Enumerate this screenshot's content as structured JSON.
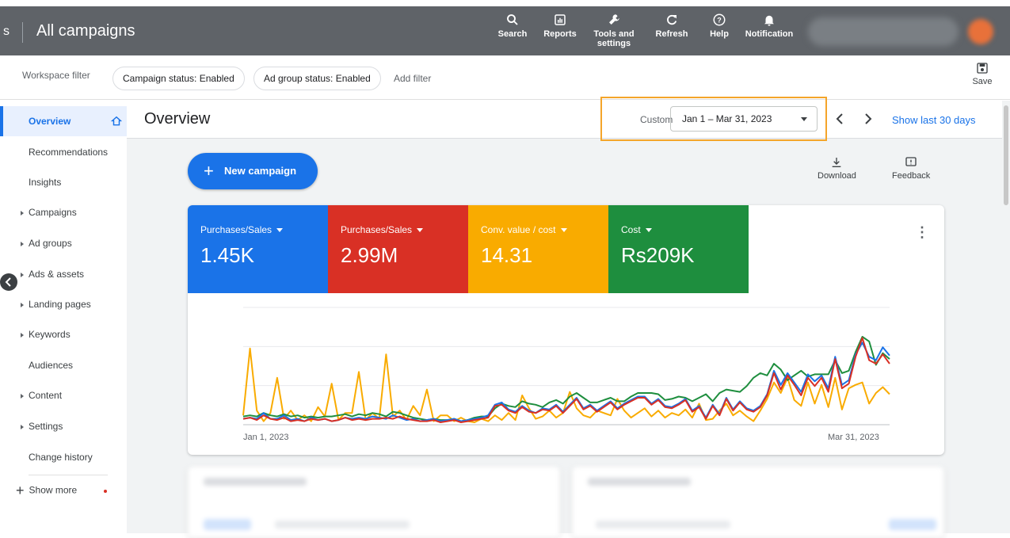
{
  "topbar": {
    "title_fragment": "s",
    "title": "All campaigns",
    "tools": [
      {
        "label": "Search",
        "icon": "search-icon"
      },
      {
        "label": "Reports",
        "icon": "reports-icon"
      },
      {
        "label": "Tools and settings",
        "icon": "wrench-icon"
      },
      {
        "label": "Refresh",
        "icon": "refresh-icon"
      },
      {
        "label": "Help",
        "icon": "help-icon"
      },
      {
        "label": "Notification",
        "icon": "bell-icon"
      }
    ]
  },
  "filterbar": {
    "workspace_filter": "Workspace filter",
    "chips": [
      "Campaign status: Enabled",
      "Ad group status: Enabled"
    ],
    "add_filter": "Add filter",
    "save": "Save"
  },
  "sidebar": {
    "items": [
      {
        "label": "Overview",
        "expandable": false,
        "active": true
      },
      {
        "label": "Recommendations",
        "expandable": false
      },
      {
        "label": "Insights",
        "expandable": false
      },
      {
        "label": "Campaigns",
        "expandable": true
      },
      {
        "label": "Ad groups",
        "expandable": true
      },
      {
        "label": "Ads & assets",
        "expandable": true
      },
      {
        "label": "Landing pages",
        "expandable": true
      },
      {
        "label": "Keywords",
        "expandable": true
      },
      {
        "label": "Audiences",
        "expandable": false
      },
      {
        "label": "Content",
        "expandable": true
      },
      {
        "label": "Settings",
        "expandable": true
      },
      {
        "label": "Change history",
        "expandable": false
      }
    ],
    "show_more": "Show more"
  },
  "main": {
    "page_title": "Overview",
    "date_custom": "Custom",
    "date_range": "Jan 1 – Mar 31, 2023",
    "show_last_30": "Show last 30 days",
    "new_campaign": "New campaign",
    "download": "Download",
    "feedback": "Feedback"
  },
  "metrics": [
    {
      "label": "Purchases/Sales",
      "value": "1.45K",
      "color": "#1a73e8"
    },
    {
      "label": "Purchases/Sales",
      "value": "2.99M",
      "color": "#d93025"
    },
    {
      "label": "Conv. value / cost",
      "value": "14.31",
      "color": "#f9ab00"
    },
    {
      "label": "Cost",
      "value": "Rs209K",
      "color": "#1e8e3e"
    }
  ],
  "chart_data": {
    "type": "line",
    "x_start_label": "Jan 1, 2023",
    "x_end_label": "Mar 31, 2023",
    "grid": true,
    "y_unit": "relative",
    "series": [
      {
        "color": "#1a73e8",
        "values": [
          0.05,
          0.06,
          0.05,
          0.1,
          0.05,
          0.05,
          0.08,
          0.04,
          0.05,
          0.03,
          0.06,
          0.04,
          0.05,
          0.03,
          0.04,
          0.06,
          0.05,
          0.06,
          0.05,
          0.07,
          0.06,
          0.05,
          0.08,
          0.06,
          0.04,
          0.05,
          0.03,
          0.04,
          0.05,
          0.03,
          0.04,
          0.05,
          0.03,
          0.04,
          0.05,
          0.06,
          0.08,
          0.17,
          0.19,
          0.13,
          0.11,
          0.16,
          0.12,
          0.1,
          0.14,
          0.13,
          0.17,
          0.11,
          0.17,
          0.23,
          0.14,
          0.17,
          0.12,
          0.16,
          0.2,
          0.14,
          0.18,
          0.21,
          0.24,
          0.24,
          0.18,
          0.22,
          0.16,
          0.15,
          0.18,
          0.22,
          0.12,
          0.16,
          0.06,
          0.17,
          0.09,
          0.23,
          0.13,
          0.2,
          0.14,
          0.12,
          0.16,
          0.26,
          0.46,
          0.34,
          0.44,
          0.36,
          0.28,
          0.43,
          0.37,
          0.42,
          0.31,
          0.58,
          0.34,
          0.38,
          0.6,
          0.7,
          0.58,
          0.55,
          0.66,
          0.59
        ]
      },
      {
        "color": "#d93025",
        "values": [
          0.05,
          0.06,
          0.04,
          0.08,
          0.05,
          0.04,
          0.06,
          0.03,
          0.04,
          0.03,
          0.05,
          0.04,
          0.05,
          0.03,
          0.04,
          0.06,
          0.04,
          0.05,
          0.04,
          0.05,
          0.05,
          0.06,
          0.05,
          0.07,
          0.05,
          0.04,
          0.03,
          0.03,
          0.04,
          0.02,
          0.03,
          0.04,
          0.02,
          0.03,
          0.04,
          0.05,
          0.06,
          0.16,
          0.17,
          0.12,
          0.1,
          0.15,
          0.11,
          0.1,
          0.13,
          0.12,
          0.16,
          0.1,
          0.16,
          0.22,
          0.13,
          0.16,
          0.11,
          0.15,
          0.19,
          0.13,
          0.17,
          0.2,
          0.23,
          0.23,
          0.17,
          0.21,
          0.15,
          0.14,
          0.17,
          0.21,
          0.11,
          0.15,
          0.05,
          0.16,
          0.08,
          0.22,
          0.12,
          0.19,
          0.13,
          0.11,
          0.15,
          0.25,
          0.44,
          0.3,
          0.42,
          0.34,
          0.25,
          0.4,
          0.33,
          0.4,
          0.28,
          0.56,
          0.31,
          0.35,
          0.58,
          0.74,
          0.55,
          0.52,
          0.6,
          0.52
        ]
      },
      {
        "color": "#f9ab00",
        "values": [
          0.08,
          0.65,
          0.12,
          0.03,
          0.1,
          0.4,
          0.05,
          0.12,
          0.04,
          0.08,
          0.03,
          0.15,
          0.07,
          0.35,
          0.04,
          0.1,
          0.1,
          0.45,
          0.04,
          0.1,
          0.05,
          0.6,
          0.07,
          0.12,
          0.04,
          0.16,
          0.08,
          0.3,
          0.03,
          0.08,
          0.08,
          0.03,
          0.06,
          0.03,
          0.02,
          0.05,
          0.03,
          0.08,
          0.04,
          0.1,
          0.04,
          0.25,
          0.14,
          0.05,
          0.07,
          0.12,
          0.06,
          0.1,
          0.28,
          0.14,
          0.08,
          0.06,
          0.12,
          0.1,
          0.08,
          0.22,
          0.12,
          0.06,
          0.1,
          0.14,
          0.07,
          0.12,
          0.06,
          0.1,
          0.08,
          0.13,
          0.06,
          0.18,
          0.04,
          0.05,
          0.12,
          0.18,
          0.08,
          0.12,
          0.07,
          0.03,
          0.12,
          0.22,
          0.36,
          0.27,
          0.4,
          0.21,
          0.16,
          0.36,
          0.18,
          0.34,
          0.15,
          0.4,
          0.13,
          0.31,
          0.34,
          0.36,
          0.18,
          0.27,
          0.32,
          0.26
        ]
      },
      {
        "color": "#1e8e3e",
        "values": [
          0.07,
          0.08,
          0.07,
          0.1,
          0.08,
          0.07,
          0.09,
          0.07,
          0.08,
          0.06,
          0.07,
          0.06,
          0.07,
          0.07,
          0.08,
          0.09,
          0.07,
          0.09,
          0.08,
          0.1,
          0.09,
          0.07,
          0.11,
          0.1,
          0.08,
          0.06,
          0.05,
          0.04,
          0.05,
          0.04,
          0.04,
          0.05,
          0.03,
          0.04,
          0.06,
          0.07,
          0.07,
          0.14,
          0.18,
          0.16,
          0.15,
          0.2,
          0.18,
          0.17,
          0.15,
          0.19,
          0.21,
          0.18,
          0.24,
          0.27,
          0.23,
          0.19,
          0.19,
          0.21,
          0.23,
          0.2,
          0.2,
          0.24,
          0.27,
          0.27,
          0.27,
          0.26,
          0.21,
          0.22,
          0.24,
          0.23,
          0.2,
          0.23,
          0.26,
          0.2,
          0.27,
          0.3,
          0.29,
          0.28,
          0.33,
          0.4,
          0.44,
          0.42,
          0.52,
          0.47,
          0.38,
          0.42,
          0.46,
          0.41,
          0.43,
          0.43,
          0.43,
          0.55,
          0.44,
          0.46,
          0.62,
          0.75,
          0.71,
          0.51,
          0.61,
          0.56
        ]
      }
    ]
  }
}
